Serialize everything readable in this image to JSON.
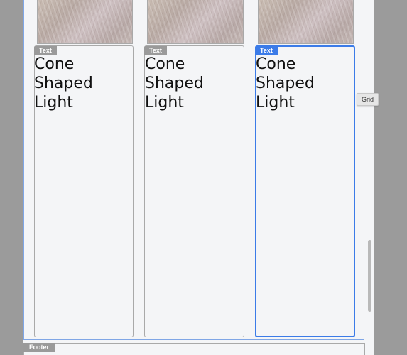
{
  "grid": {
    "tag_label": "Grid"
  },
  "cards": [
    {
      "tag_label": "Text",
      "heading": "Cone Shaped Light"
    },
    {
      "tag_label": "Text",
      "heading": "Cone Shaped Light"
    },
    {
      "tag_label": "Text",
      "heading": "Cone Shaped Light"
    }
  ],
  "footer": {
    "tag_label": "Footer"
  },
  "colors": {
    "selection": "#3b7be8",
    "tag_gray": "#9a9a9a"
  }
}
